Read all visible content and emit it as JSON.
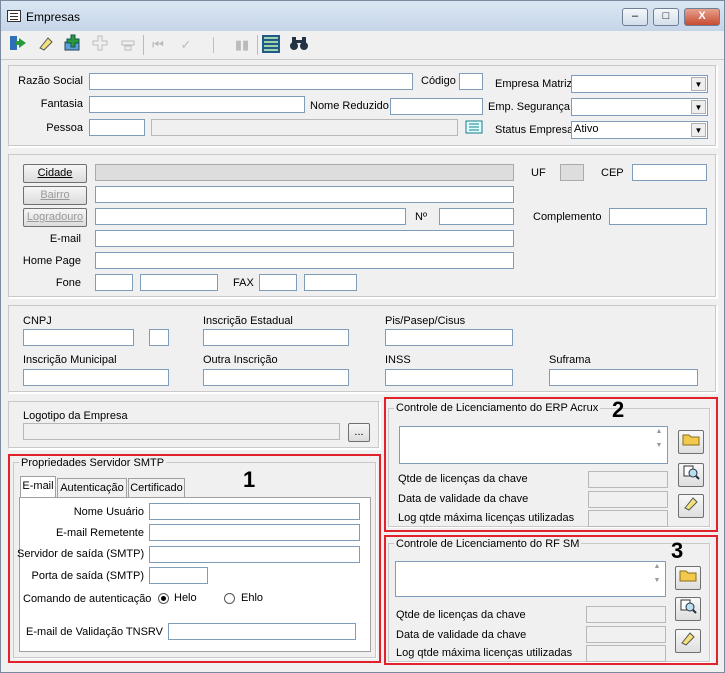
{
  "window": {
    "title": "Empresas",
    "min": "–",
    "max": "□",
    "close": "X"
  },
  "toolbar": {
    "icons": [
      "exit-icon",
      "eraser-icon",
      "add-icon",
      "add-disabled-icon",
      "remove-disabled-icon",
      "first-disabled-icon",
      "prev-disabled-icon",
      "next-disabled-icon",
      "last-disabled-icon",
      "grid-icon",
      "binoculars-icon"
    ]
  },
  "empresa": {
    "razao_social": "Razão Social",
    "codigo": "Código",
    "empresa_matriz": "Empresa Matriz",
    "fantasia": "Fantasia",
    "nome_reduzido": "Nome Reduzido",
    "emp_seguranca": "Emp. Segurança",
    "pessoa": "Pessoa",
    "status_empresa": "Status Empresa",
    "status_value": "Ativo"
  },
  "endereco": {
    "cidade": "Cidade",
    "bairro": "Bairro",
    "logradouro": "Logradouro",
    "uf": "UF",
    "cep": "CEP",
    "numero": "Nº",
    "complemento": "Complemento",
    "email": "E-mail",
    "home_page": "Home Page",
    "fone": "Fone",
    "fax": "FAX"
  },
  "documentos": {
    "cnpj": "CNPJ",
    "inscricao_estadual": "Inscrição Estadual",
    "pis": "Pis/Pasep/Cisus",
    "inscricao_municipal": "Inscrição Municipal",
    "outra_inscricao": "Outra Inscrição",
    "inss": "INSS",
    "suframa": "Suframa"
  },
  "logotipo": {
    "label": "Logotipo da Empresa",
    "browse": "..."
  },
  "smtp": {
    "title": "Propriedades Servidor SMTP",
    "tabs": [
      "E-mail",
      "Autenticação",
      "Certificado"
    ],
    "nome_usuario": "Nome Usuário",
    "email_remetente": "E-mail Remetente",
    "servidor_saida": "Servidor de saída (SMTP)",
    "porta_saida": "Porta de saída (SMTP)",
    "comando": "Comando de autenticação",
    "helo": "Helo",
    "ehlo": "Ehlo",
    "email_validacao": "E-mail de Validação TNSRV",
    "annotation": "1"
  },
  "erp": {
    "title": "Controle de Licenciamento do ERP Acrux",
    "qtde": "Qtde de licenças da chave",
    "validade": "Data de validade da chave",
    "log": "Log qtde máxima licenças utilizadas",
    "annotation": "2"
  },
  "rfsm": {
    "title": "Controle de Licenciamento do RF SM",
    "qtde": "Qtde de licenças da chave",
    "validade": "Data de validade da chave",
    "log": "Log qtde máxima licenças utilizadas",
    "annotation": "3"
  },
  "colors": {
    "highlight": "#e2222b",
    "input_border": "#7f9db9"
  }
}
